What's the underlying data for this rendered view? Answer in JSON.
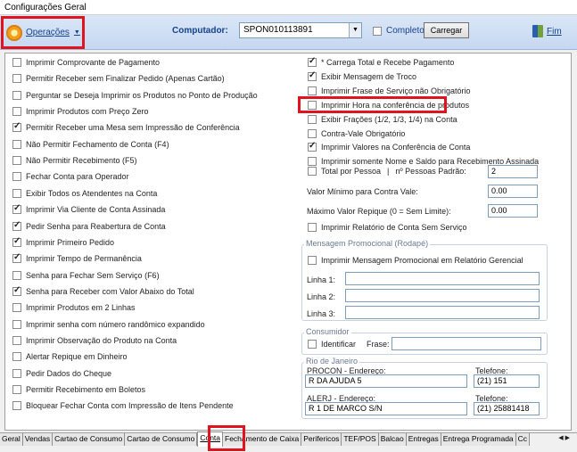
{
  "window": {
    "title": "Configurações Geral"
  },
  "toolbar": {
    "operacoes_label": "Operações",
    "computador_label": "Computador:",
    "computador_value": "SPON010113891",
    "completo_label": "Completo",
    "completo_checked": false,
    "carregar_label": "Carregar",
    "fim_label": "Fim"
  },
  "left_options": [
    {
      "label": "Imprimir Comprovante de Pagamento",
      "checked": false
    },
    {
      "label": "Permitir Receber sem Finalizar Pedido (Apenas Cartão)",
      "checked": false
    },
    {
      "label": "Perguntar se Deseja Imprimir os Produtos no Ponto de Produção",
      "checked": false
    },
    {
      "label": "Imprimir Produtos com Preço Zero",
      "checked": false
    },
    {
      "label": "Permitir Receber uma Mesa sem Impressão de Conferência",
      "checked": true
    },
    {
      "label": "Não Permitir Fechamento de Conta (F4)",
      "checked": false
    },
    {
      "label": "Não Permitir Recebimento (F5)",
      "checked": false
    },
    {
      "label": "Fechar Conta para Operador",
      "checked": false
    },
    {
      "label": "Exibir Todos os Atendentes na Conta",
      "checked": false
    },
    {
      "label": "Imprimir Via Cliente de Conta Assinada",
      "checked": true
    },
    {
      "label": "Pedir Senha para Reabertura de Conta",
      "checked": true
    },
    {
      "label": "Imprimir Primeiro Pedido",
      "checked": true
    },
    {
      "label": "Imprimir Tempo de Permanência",
      "checked": true
    },
    {
      "label": "Senha para Fechar Sem Serviço (F6)",
      "checked": false
    },
    {
      "label": "Senha para Receber com Valor Abaixo do Total",
      "checked": true
    },
    {
      "label": "Imprimir Produtos em 2 Linhas",
      "checked": false
    },
    {
      "label": "Imprimir senha com número randômico expandido",
      "checked": false
    },
    {
      "label": "Imprimir Observação do Produto na Conta",
      "checked": false
    },
    {
      "label": "Alertar Repique em Dinheiro",
      "checked": false
    },
    {
      "label": "Pedir Dados do Cheque",
      "checked": false
    },
    {
      "label": "Permitir Recebimento em Boletos",
      "checked": false
    },
    {
      "label": "Bloquear Fechar Conta com Impressão de Itens Pendente",
      "checked": false
    }
  ],
  "right_options": [
    {
      "label": "* Carrega Total e Recebe Pagamento",
      "checked": true
    },
    {
      "label": "Exibir Mensagem de Troco",
      "checked": true
    },
    {
      "label": "Imprimir Frase de Serviço não Obrigatório",
      "checked": false
    },
    {
      "label": "Imprimir Hora na conferência de produtos",
      "checked": false
    },
    {
      "label": "Exibir Frações (1/2, 1/3, 1/4) na Conta",
      "checked": false
    },
    {
      "label": "Contra-Vale Obrigatório",
      "checked": false
    },
    {
      "label": "Imprimir Valores na Conferência de Conta",
      "checked": true
    },
    {
      "label": "Imprimir somente Nome e Saldo para Recebimento Assinada",
      "checked": false
    }
  ],
  "total_pessoa": {
    "label": "Total por Pessoa",
    "checked": false,
    "sep": "|",
    "pessoas_label": "nº Pessoas Padrão:",
    "pessoas_value": "2"
  },
  "valor_minimo": {
    "label": "Valor Mínimo para Contra Vale:",
    "value": "0.00"
  },
  "maximo_repique": {
    "label": "Máximo Valor Repique (0 = Sem Limite):",
    "value": "0.00"
  },
  "relatorio_sem_servico": {
    "label": "Imprimir Relatório de Conta Sem Serviço",
    "checked": false
  },
  "mensagem_promocional": {
    "title": "Mensagem Promocional (Rodapé)",
    "print_label": "Imprimir Mensagem Promocional em Relatório Gerencial",
    "print_checked": false,
    "linha1_label": "Linha 1:",
    "linha1_value": "",
    "linha2_label": "Linha 2:",
    "linha2_value": "",
    "linha3_label": "Linha 3:",
    "linha3_value": ""
  },
  "consumidor": {
    "title": "Consumidor",
    "identificar_label": "Identificar",
    "identificar_checked": false,
    "frase_label": "Frase:",
    "frase_value": ""
  },
  "rio": {
    "title": "Rio de Janeiro",
    "procon_label": "PROCON - Endereço:",
    "procon_value": "R DA AJUDA 5",
    "procon_tel_label": "Telefone:",
    "procon_tel_value": "(21) 151",
    "alerj_label": "ALERJ - Endereço:",
    "alerj_value": "R 1 DE MARCO S/N",
    "alerj_tel_label": "Telefone:",
    "alerj_tel_value": "(21) 25881418"
  },
  "tabs": [
    "Geral",
    "Vendas",
    "Cartao de Consumo",
    "Cartao de Consumo",
    "Conta",
    "Fechamento de Caixa",
    "Perifericos",
    "TEF/POS",
    "Balcao",
    "Entregas",
    "Entrega Programada",
    "Cc"
  ],
  "active_tab": "Conta",
  "colors": {
    "highlight": "#e0141e",
    "accent": "#15428b"
  }
}
